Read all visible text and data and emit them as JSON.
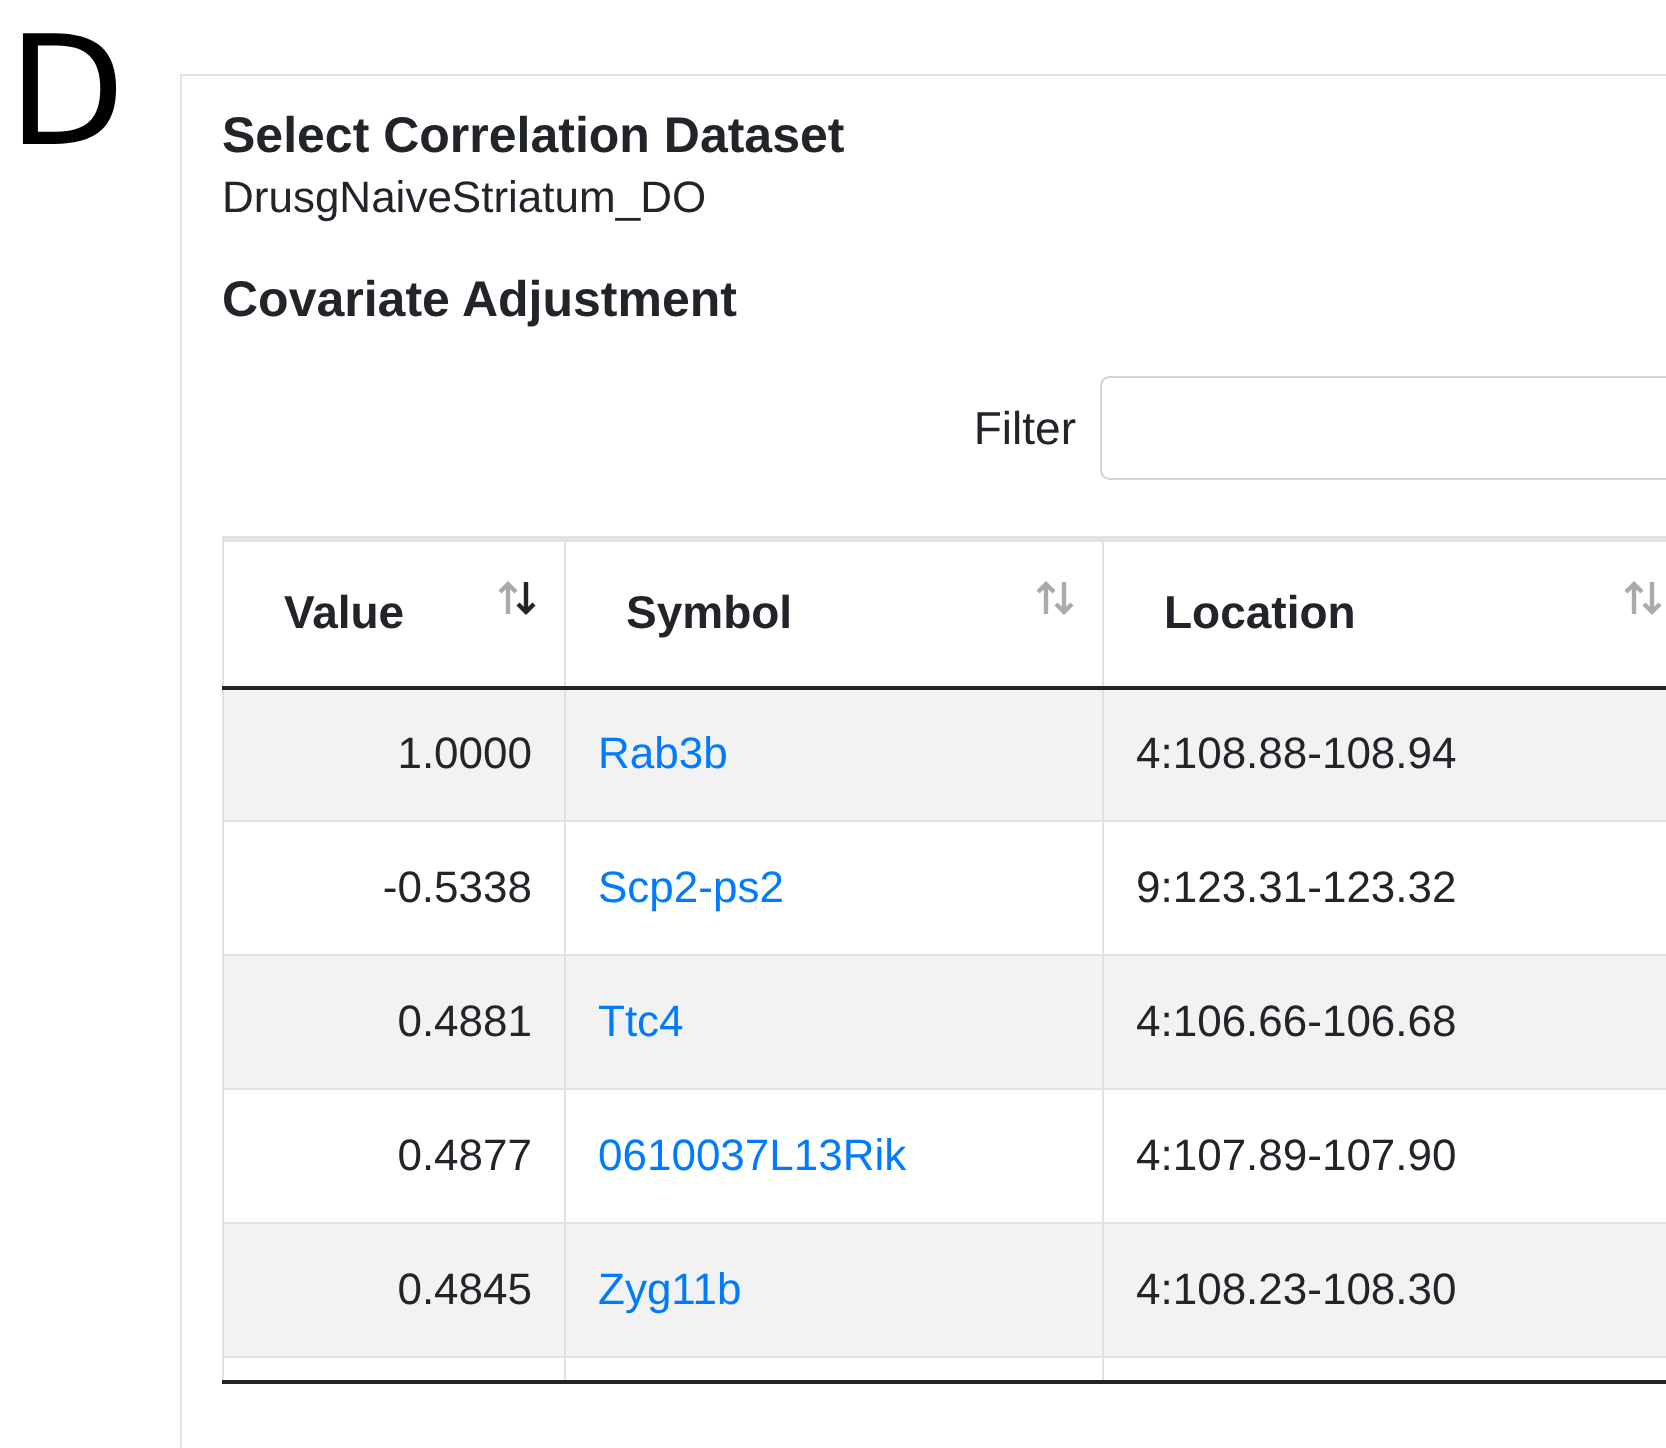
{
  "panel_label": "D",
  "dataset": {
    "heading": "Select Correlation Dataset",
    "value": "DrusgNaiveStriatum_DO"
  },
  "covariate": {
    "heading": "Covariate Adjustment"
  },
  "filter": {
    "label": "Filter"
  },
  "table": {
    "columns": [
      {
        "label": "Value",
        "kind": "number",
        "sorted_descending": true
      },
      {
        "label": "Symbol",
        "kind": "link",
        "sorted_descending": false
      },
      {
        "label": "Location",
        "kind": "text",
        "sorted_descending": false
      }
    ],
    "rows": [
      {
        "value": "1.0000",
        "symbol": "Rab3b",
        "location": "4:108.88-108.94"
      },
      {
        "value": "-0.5338",
        "symbol": "Scp2-ps2",
        "location": "9:123.31-123.32"
      },
      {
        "value": "0.4881",
        "symbol": "Ttc4",
        "location": "4:106.66-106.68"
      },
      {
        "value": "0.4877",
        "symbol": "0610037L13Rik",
        "location": "4:107.89-107.90"
      },
      {
        "value": "0.4845",
        "symbol": "Zyg11b",
        "location": "4:108.23-108.30"
      }
    ]
  }
}
